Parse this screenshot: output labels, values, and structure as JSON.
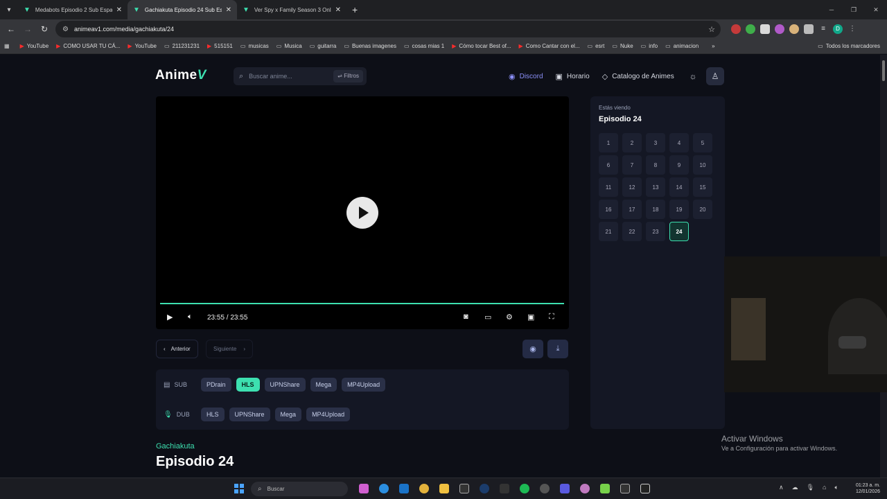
{
  "browser": {
    "tabs": [
      {
        "title": "Medabots Episodio 2 Sub Espa",
        "active": false
      },
      {
        "title": "Gachiakuta Episodio 24 Sub Es",
        "active": true
      },
      {
        "title": "Ver Spy x Family Season 3 Onl",
        "active": false
      }
    ],
    "url": "animeav1.com/media/gachiakuta/24",
    "bookmarks": [
      {
        "label": "YouTube",
        "icon": "youtube-icon"
      },
      {
        "label": "COMO USAR TU CÁ...",
        "icon": "youtube-icon"
      },
      {
        "label": "YouTube",
        "icon": "youtube-icon"
      },
      {
        "label": "211231231",
        "icon": "folder-icon"
      },
      {
        "label": "515151",
        "icon": "youtube-icon"
      },
      {
        "label": "musicas",
        "icon": "folder-icon"
      },
      {
        "label": "Musica",
        "icon": "folder-icon"
      },
      {
        "label": "guitarra",
        "icon": "folder-icon"
      },
      {
        "label": "Buenas imagenes",
        "icon": "folder-icon"
      },
      {
        "label": "cosas mias 1",
        "icon": "folder-icon"
      },
      {
        "label": "Cómo tocar Best of...",
        "icon": "youtube-icon"
      },
      {
        "label": "Como Cantar con el...",
        "icon": "youtube-icon"
      },
      {
        "label": "esrt",
        "icon": "folder-icon"
      },
      {
        "label": "Nuke",
        "icon": "folder-icon"
      },
      {
        "label": "info",
        "icon": "folder-icon"
      },
      {
        "label": "animacion",
        "icon": "folder-icon"
      }
    ],
    "all_bookmarks": "Todos los marcadores",
    "profile_initial": "D"
  },
  "site": {
    "logo": "Anime",
    "logo_mark": "V",
    "search_placeholder": "Buscar anime...",
    "filters_label": "Filtros",
    "nav": {
      "discord": "Discord",
      "schedule": "Horario",
      "catalog": "Catalogo de Animes"
    }
  },
  "player": {
    "time": "23:55 / 23:55",
    "progress": 1.0
  },
  "episode_nav": {
    "prev": "Anterior",
    "next": "Siguiente"
  },
  "servers": {
    "sub_label": "SUB",
    "sub": [
      "PDrain",
      "HLS",
      "UPNShare",
      "Mega",
      "MP4Upload"
    ],
    "sub_selected": "HLS",
    "dub_label": "DUB",
    "dub": [
      "HLS",
      "UPNShare",
      "Mega",
      "MP4Upload"
    ]
  },
  "series": {
    "name": "Gachiakuta",
    "episode_title": "Episodio 24"
  },
  "sidebar": {
    "watching_label": "Estás viendo",
    "current_episode": "Episodio 24",
    "episodes": [
      "1",
      "2",
      "3",
      "4",
      "5",
      "6",
      "7",
      "8",
      "9",
      "10",
      "11",
      "12",
      "13",
      "14",
      "15",
      "16",
      "17",
      "18",
      "19",
      "20",
      "21",
      "22",
      "23",
      "24"
    ],
    "current": "24"
  },
  "windows": {
    "activate_title": "Activar Windows",
    "activate_sub": "Ve a Configuración para activar Windows.",
    "search": "Buscar",
    "clock_time": "01:23 a. m.",
    "clock_date": "12/01/2026"
  },
  "colors": {
    "accent": "#3de0b0",
    "discord": "#8b8ff8",
    "background": "#0d0f17"
  }
}
